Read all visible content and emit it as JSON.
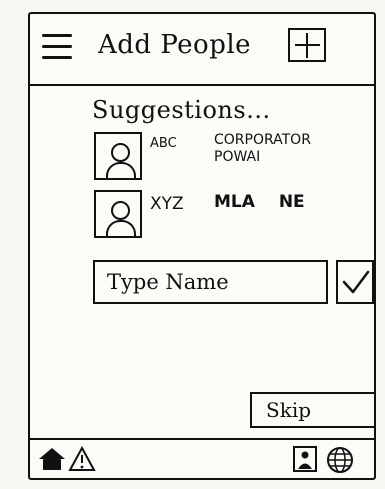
{
  "header": {
    "title": "Add People",
    "menu_icon": "hamburger-menu-icon",
    "add_icon": "plus-icon"
  },
  "suggestions": {
    "label": "Suggestions...",
    "people": [
      {
        "name": "ABC",
        "role": "CORPORATOR POWAI"
      },
      {
        "name": "XYZ",
        "role": "MLA NE"
      }
    ]
  },
  "name_input": {
    "placeholder": "Type Name"
  },
  "confirm_icon": "check-icon",
  "skip": {
    "label": "Skip"
  },
  "footer": {
    "icons": [
      "home-icon",
      "warning-icon",
      "profile-icon",
      "globe-icon"
    ]
  }
}
